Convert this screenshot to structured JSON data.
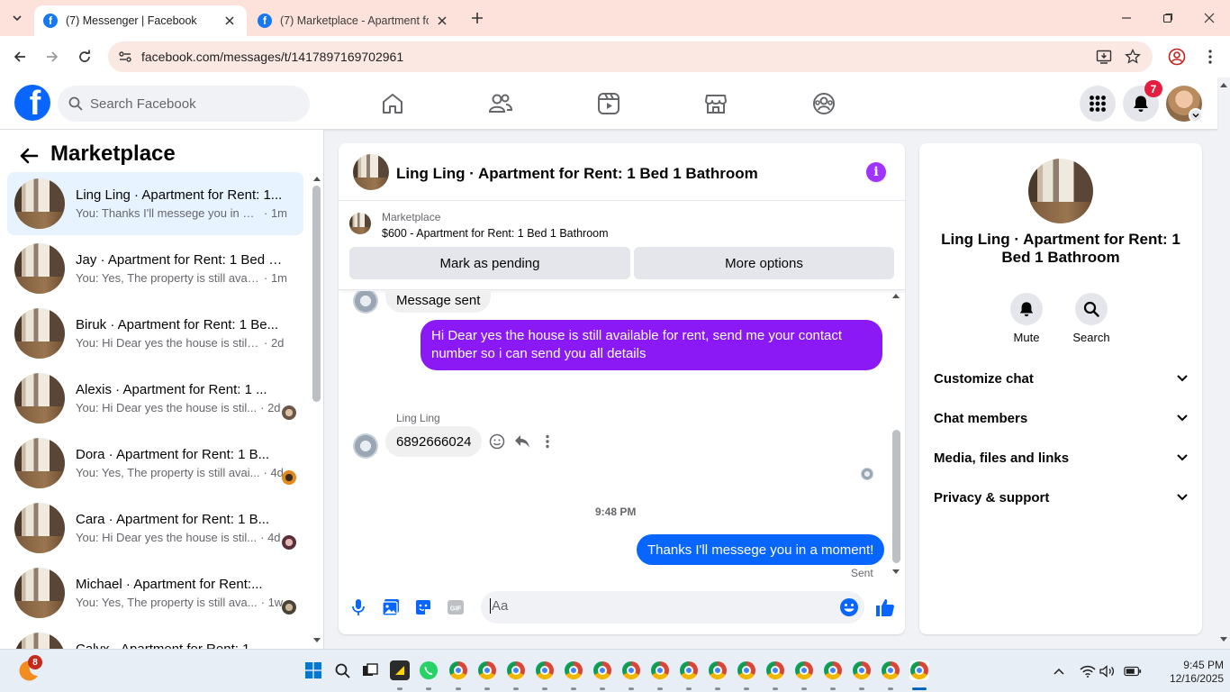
{
  "browser": {
    "tabs": [
      {
        "title": "(7) Messenger | Facebook",
        "active": true
      },
      {
        "title": "(7) Marketplace - Apartment fo",
        "active": false
      }
    ],
    "url": "facebook.com/messages/t/1417897169702961"
  },
  "fb_header": {
    "logo": "f",
    "search_placeholder": "Search Facebook",
    "notification_count": "7"
  },
  "left_panel": {
    "title": "Marketplace",
    "conversations": [
      {
        "name": "Ling Ling · Apartment for Rent: 1...",
        "preview": "You: Thanks I'll messege you in a ...",
        "time": "· 1m",
        "selected": true
      },
      {
        "name": "Jay · Apartment for Rent: 1 Bed 1...",
        "preview": "You: Yes, The property is still availa...",
        "time": "· 1m"
      },
      {
        "name": "Biruk · Apartment for Rent: 1 Be...",
        "preview": "You: Hi Dear yes the house is still a...",
        "time": "· 2d"
      },
      {
        "name": "Alexis · Apartment for Rent: 1 ...",
        "preview": "You: Hi Dear yes the house is stil...",
        "time": "· 2d"
      },
      {
        "name": "Dora · Apartment for Rent: 1 B...",
        "preview": "You: Yes, The property is still avai...",
        "time": "· 4d"
      },
      {
        "name": "Cara · Apartment for Rent: 1 B...",
        "preview": "You: Hi Dear yes the house is stil...",
        "time": "· 4d"
      },
      {
        "name": "Michael · Apartment for Rent:...",
        "preview": "You: Yes, The property is still ava...",
        "time": "· 1w"
      },
      {
        "name": "Calyx · Apartment for Rent: 1",
        "preview": "",
        "time": ""
      }
    ]
  },
  "chat": {
    "header_name": "Ling Ling · Apartment for Rent: 1 Bed 1 Bathroom",
    "marketplace_label": "Marketplace",
    "listing": "$600 - Apartment for Rent: 1 Bed 1 Bathroom",
    "mark_pending": "Mark as pending",
    "more_options": "More options",
    "messages": {
      "partial_in": "Message sent",
      "out1": "Hi Dear yes the house is still available for rent, send me your contact number so i can send you all details",
      "sender": "Ling Ling",
      "in_number": "6892666024",
      "timestamp": "9:48 PM",
      "out2": "Thanks I'll messege you in a moment!",
      "status": "Sent"
    },
    "composer_placeholder": "Aa"
  },
  "info_panel": {
    "name": "Ling Ling · Apartment for Rent: 1 Bed 1 Bathroom",
    "mute": "Mute",
    "search": "Search",
    "sections": [
      "Customize chat",
      "Chat members",
      "Media, files and links",
      "Privacy & support"
    ]
  },
  "taskbar": {
    "weather_badge": "8",
    "time": "9:45 PM",
    "date": "12/16/2025"
  },
  "colors": {
    "fb_blue": "#0866ff",
    "purple_bubble": "#8a19f5",
    "notif_red": "#e41e3f"
  }
}
